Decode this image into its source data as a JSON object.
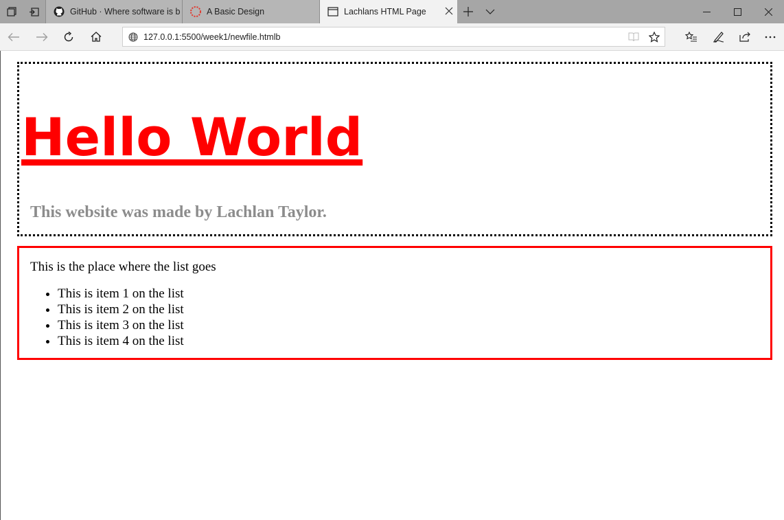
{
  "browser": {
    "tabs": [
      {
        "title": "GitHub · Where software is b",
        "icon": "github-icon"
      },
      {
        "title": "A Basic Design",
        "icon": "loading-spinner-icon"
      },
      {
        "title": "Lachlans HTML Page",
        "icon": "page-icon",
        "active": true
      }
    ],
    "address": {
      "url": "127.0.0.1:5500/week1/newfile.htmlb"
    }
  },
  "page": {
    "heading": "Hello World",
    "byline": "This website was made by Lachlan Taylor.",
    "list_intro": "This is the place where the list goes",
    "list_items": [
      "This is item 1 on the list",
      "This is item 2 on the list",
      "This is item 3 on the list",
      "This is item 4 on the list"
    ]
  },
  "colors": {
    "heading": "#ff0000",
    "byline": "#8c8c8c",
    "list_border": "#ff0000",
    "header_border": "#000000"
  }
}
